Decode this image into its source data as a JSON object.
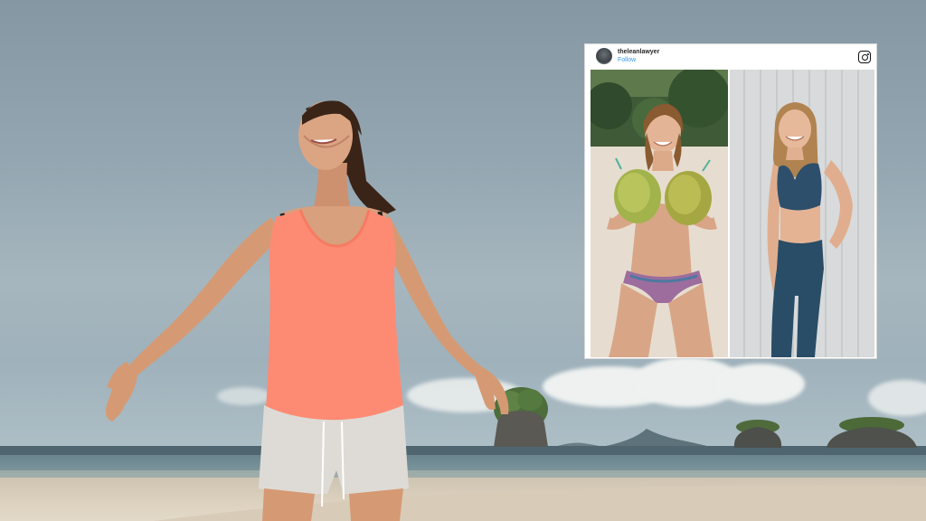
{
  "instagram_post": {
    "username": "theleanlawyer",
    "follow_label": "Follow",
    "logo_icon": "instagram-icon",
    "avatar_icon": "profile-avatar"
  },
  "scene": {
    "description_icons": [
      "woman-on-beach",
      "beach-rocks",
      "clouds"
    ],
    "colors": {
      "sky": "#93a6b1",
      "sea": "#6f8a93",
      "sand": "#ddd2bf",
      "tank_top": "#fd8b74",
      "shorts": "#d9d6d2"
    }
  }
}
